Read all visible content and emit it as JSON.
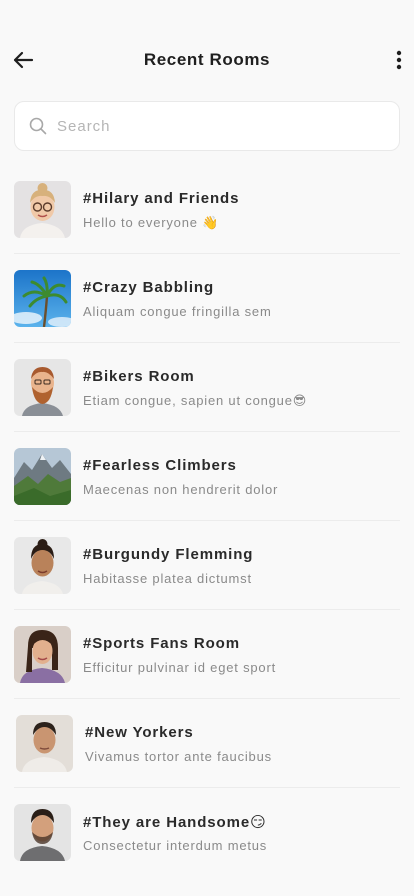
{
  "header": {
    "title": "Recent Rooms",
    "back_icon": "arrow-left-icon",
    "menu_icon": "more-vertical-icon"
  },
  "search": {
    "placeholder": "Search",
    "value": "",
    "icon": "search-icon"
  },
  "rooms": [
    {
      "name": "#Hilary and Friends",
      "message": "Hello to everyone 👋"
    },
    {
      "name": "#Crazy Babbling",
      "message": "Aliquam congue fringilla sem"
    },
    {
      "name": "#Bikers Room",
      "message": "Etiam congue, sapien ut congue😎"
    },
    {
      "name": "#Fearless Climbers",
      "message": "Maecenas non hendrerit dolor"
    },
    {
      "name": "#Burgundy Flemming",
      "message": "Habitasse platea dictumst"
    },
    {
      "name": "#Sports Fans Room",
      "message": "Efficitur pulvinar id eget sport"
    },
    {
      "name": "#New Yorkers",
      "message": "Vivamus tortor ante faucibus"
    },
    {
      "name": "#They are Handsome😏",
      "message": "Consectetur interdum metus"
    }
  ],
  "colors": {
    "background": "#f9f9f9",
    "title": "#1f1f1f",
    "subtitle": "#8a8a8a",
    "divider": "#ececec"
  }
}
